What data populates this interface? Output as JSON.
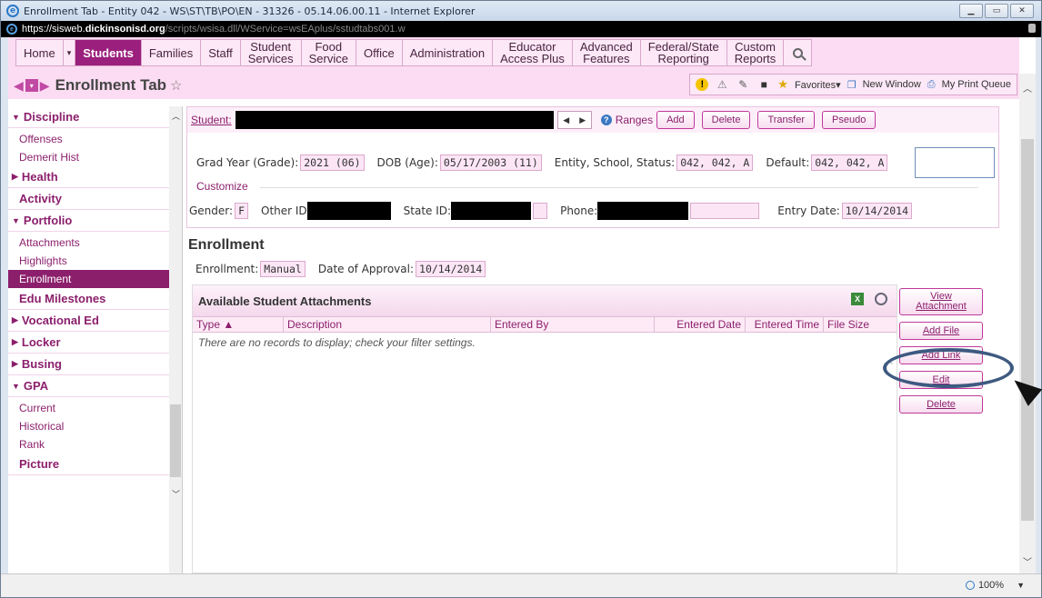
{
  "window": {
    "title": "Enrollment Tab - Entity 042 - WS\\ST\\TB\\PO\\EN - 31326 - 05.14.06.00.11 - Internet Explorer",
    "controls": [
      "minimize",
      "maximize",
      "close"
    ]
  },
  "address": {
    "prefix": "https://sisweb.",
    "host": "dickinsonisd.org",
    "path": "/scripts/wsisa.dll/WService=wsEAplus/sstudtabs001.w"
  },
  "menu": {
    "items": [
      {
        "label": "Home"
      },
      {
        "label": "▾"
      },
      {
        "label": "Students"
      },
      {
        "label": "Families"
      },
      {
        "label": "Staff"
      },
      {
        "label": "Student\nServices"
      },
      {
        "label": "Food\nService"
      },
      {
        "label": "Office"
      },
      {
        "label": "Administration"
      },
      {
        "label": "Educator\nAccess Plus"
      },
      {
        "label": "Advanced\nFeatures"
      },
      {
        "label": "Federal/State\nReporting"
      },
      {
        "label": "Custom\nReports"
      }
    ],
    "active": "Students"
  },
  "page": {
    "title": "Enrollment Tab"
  },
  "toolbar": {
    "favorites": "Favorites▾",
    "new_window": "New Window",
    "print_queue": "My Print Queue"
  },
  "sidebar": {
    "discipline": "Discipline",
    "offenses": "Offenses",
    "demerit_hist": "Demerit Hist",
    "health": "Health",
    "activity": "Activity",
    "portfolio": "Portfolio",
    "attachments": "Attachments",
    "highlights": "Highlights",
    "enrollment": "Enrollment",
    "edu_milestones": "Edu Milestones",
    "vocational_ed": "Vocational Ed",
    "locker": "Locker",
    "busing": "Busing",
    "gpa": "GPA",
    "current": "Current",
    "historical": "Historical",
    "rank": "Rank",
    "picture": "Picture"
  },
  "student": {
    "label": "Student:",
    "ranges": "Ranges",
    "buttons": {
      "add": "Add",
      "delete": "Delete",
      "transfer": "Transfer",
      "pseudo": "Pseudo"
    },
    "grad_year_label": "Grad Year (Grade):",
    "grad_year_value": "2021 (06)",
    "dob_label": "DOB (Age):",
    "dob_value": "05/17/2003 (11)",
    "entity_label": "Entity, School, Status:",
    "entity_value": "042, 042, A",
    "default_label": "Default:",
    "default_value": "042, 042, A",
    "customize": "Customize",
    "gender_label": "Gender:",
    "gender_value": "F",
    "other_id_label": "Other ID",
    "state_id_label": "State ID:",
    "phone_label": "Phone:",
    "entry_date_label": "Entry Date:",
    "entry_date_value": "10/14/2014"
  },
  "enrollment": {
    "section_title": "Enrollment",
    "enrollment_label": "Enrollment:",
    "enrollment_value": "Manual",
    "approval_label": "Date of Approval:",
    "approval_value": "10/14/2014"
  },
  "grid": {
    "title": "Available Student Attachments",
    "columns": [
      "Type ▲",
      "Description",
      "Entered By",
      "Entered Date",
      "Entered Time",
      "File Size"
    ],
    "empty_message": "There are no records to display; check your filter settings."
  },
  "actions": {
    "view_attachment_1": "View",
    "view_attachment_2": "Attachment",
    "add_file": "Add File",
    "add_link": "Add Link",
    "edit": "Edit",
    "delete": "Delete"
  },
  "status": {
    "zoom": "100%"
  }
}
